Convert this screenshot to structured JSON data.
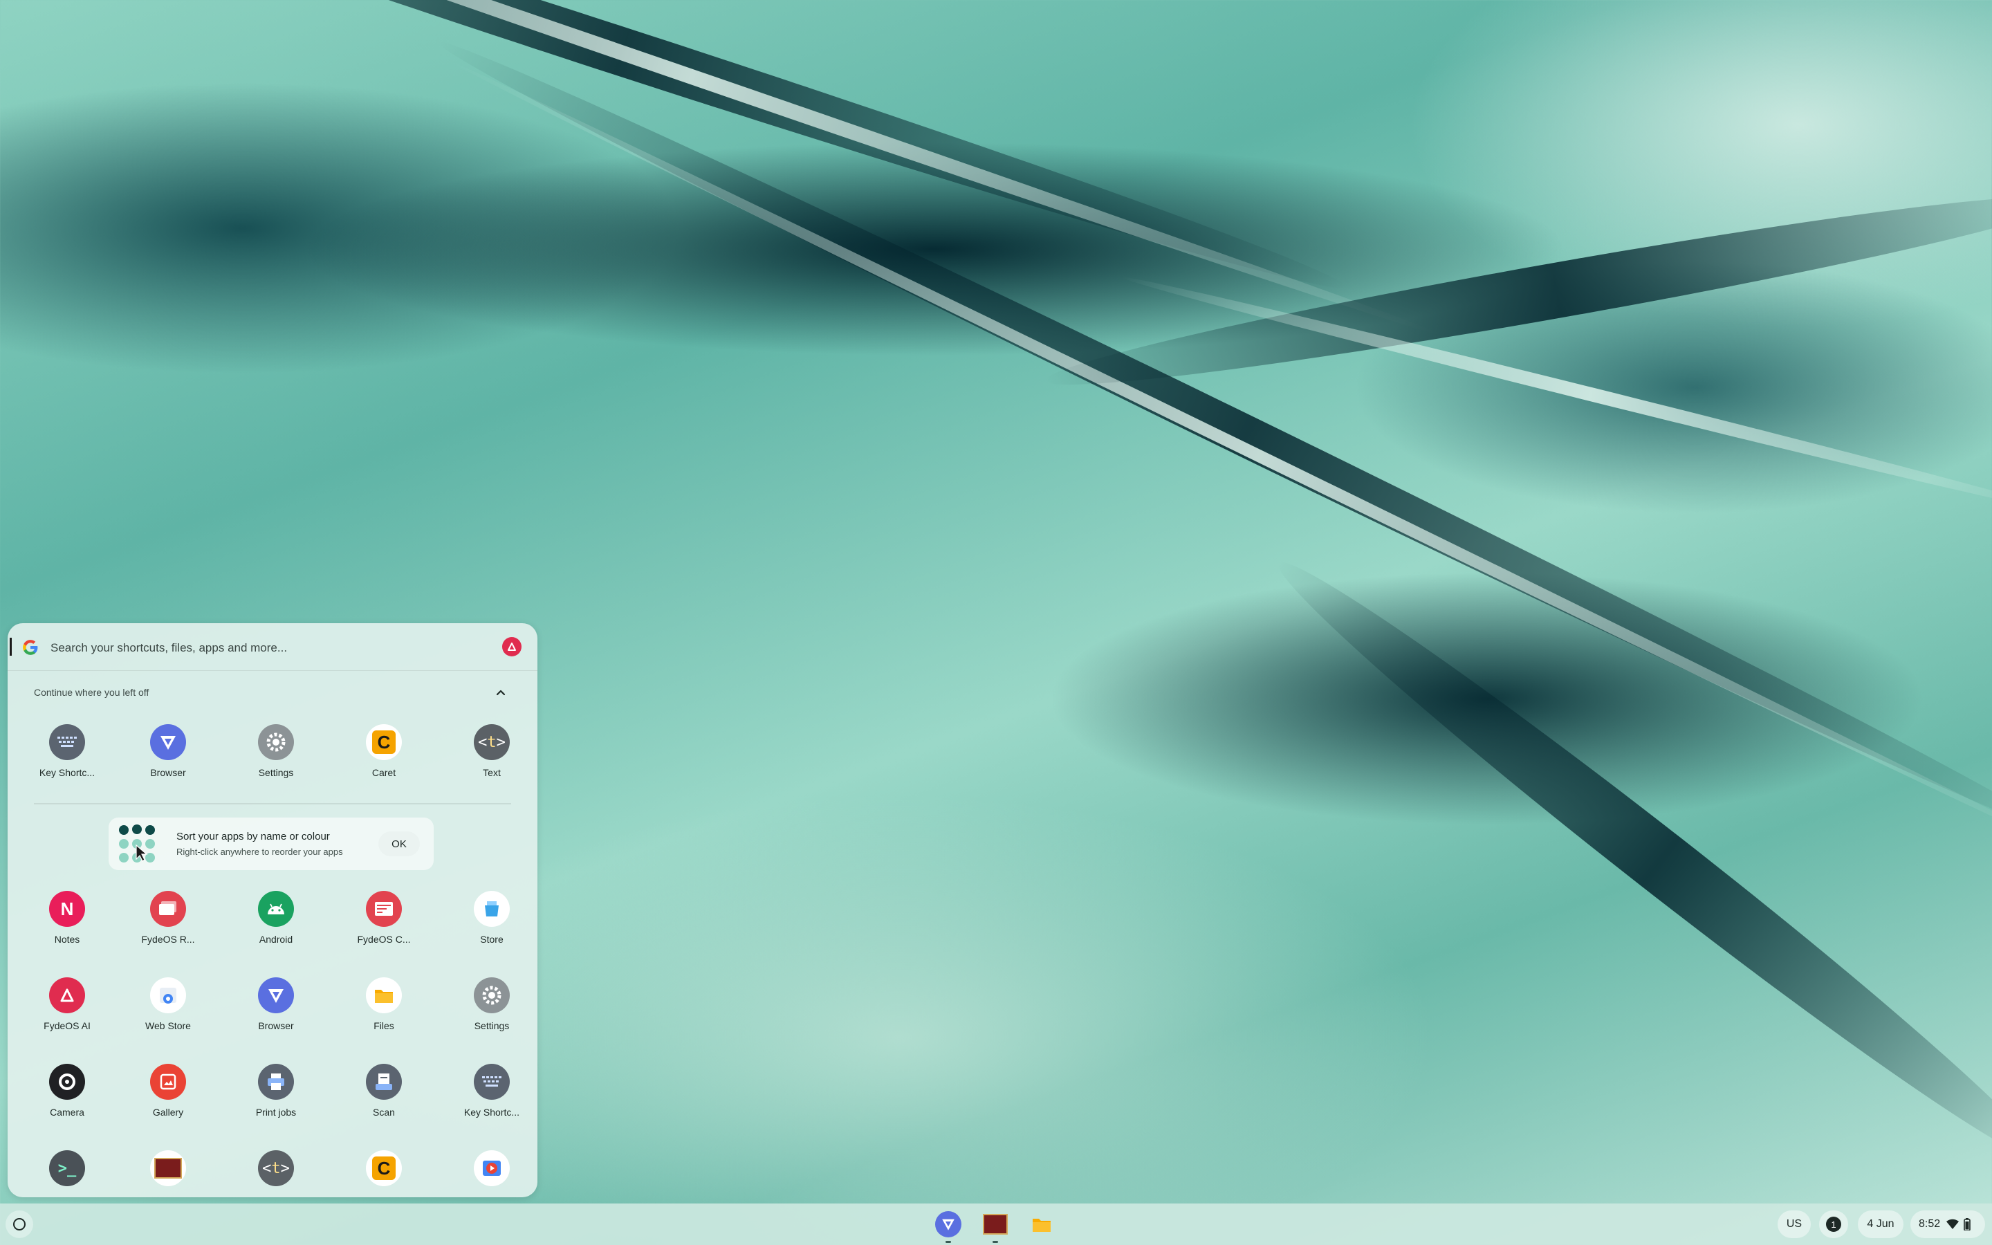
{
  "launcher": {
    "search": {
      "placeholder": "Search your shortcuts, files, apps and more..."
    },
    "continue_section": {
      "title": "Continue where you left off",
      "items": [
        {
          "label": "Key Shortc...",
          "icon": "keyboard-shortcuts-icon"
        },
        {
          "label": "Browser",
          "icon": "browser-icon"
        },
        {
          "label": "Settings",
          "icon": "settings-gear-icon"
        },
        {
          "label": "Caret",
          "icon": "caret-editor-icon"
        },
        {
          "label": "Text",
          "icon": "text-editor-icon"
        }
      ]
    },
    "sort_tip": {
      "title": "Sort your apps by name or colour",
      "subtitle": "Right-click anywhere to reorder your apps",
      "ok_label": "OK"
    },
    "apps": [
      {
        "label": "Notes",
        "icon": "notes-icon"
      },
      {
        "label": "FydeOS R...",
        "icon": "fydeos-remote-icon"
      },
      {
        "label": "Android",
        "icon": "android-icon"
      },
      {
        "label": "FydeOS C...",
        "icon": "fydeos-connect-icon"
      },
      {
        "label": "Store",
        "icon": "store-icon"
      },
      {
        "label": "FydeOS AI",
        "icon": "fydeos-ai-icon"
      },
      {
        "label": "Web Store",
        "icon": "web-store-icon"
      },
      {
        "label": "Browser",
        "icon": "browser-icon"
      },
      {
        "label": "Files",
        "icon": "files-folder-icon"
      },
      {
        "label": "Settings",
        "icon": "settings-gear-icon"
      },
      {
        "label": "Camera",
        "icon": "camera-icon"
      },
      {
        "label": "Gallery",
        "icon": "gallery-icon"
      },
      {
        "label": "Print jobs",
        "icon": "printer-icon"
      },
      {
        "label": "Scan",
        "icon": "scanner-icon"
      },
      {
        "label": "Key Shortc...",
        "icon": "keyboard-shortcuts-icon"
      },
      {
        "label": "",
        "icon": "terminal-icon"
      },
      {
        "label": "",
        "icon": "media-app-icon"
      },
      {
        "label": "",
        "icon": "text-editor-icon"
      },
      {
        "label": "",
        "icon": "caret-editor-icon"
      },
      {
        "label": "",
        "icon": "video-player-icon"
      }
    ]
  },
  "shelf": {
    "pinned": [
      {
        "name": "browser",
        "icon": "browser-icon"
      },
      {
        "name": "media",
        "icon": "media-app-icon"
      },
      {
        "name": "files",
        "icon": "files-folder-icon"
      }
    ],
    "tray": {
      "ime": "US",
      "notifications_count": "1",
      "date": "4 Jun",
      "time": "8:52"
    }
  },
  "colors": {
    "accent": "#5a6fe0",
    "ai_red": "#e02c4f"
  }
}
